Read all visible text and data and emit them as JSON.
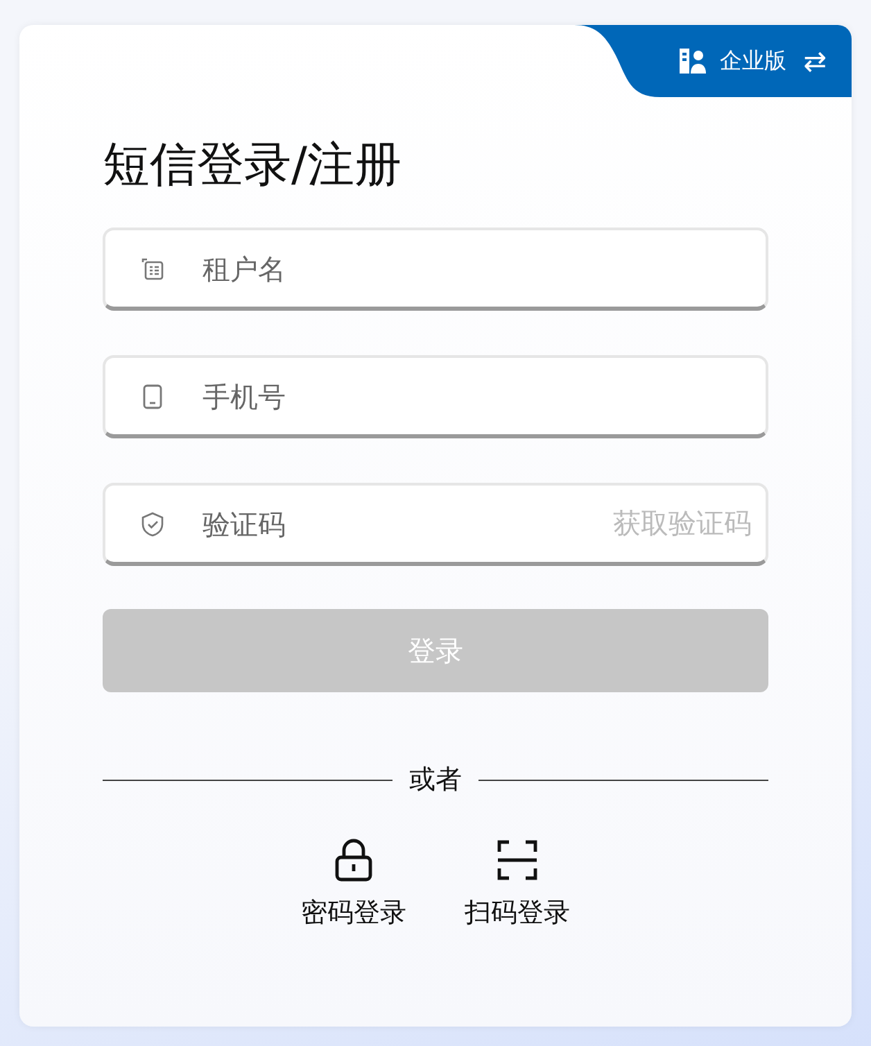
{
  "edition_switch": {
    "label": "企业版",
    "switch_glyph": "⇄"
  },
  "title": "短信登录/注册",
  "fields": [
    {
      "kind": "tenant",
      "placeholder": "租户名"
    },
    {
      "kind": "phone",
      "placeholder": "手机号"
    },
    {
      "kind": "code",
      "placeholder": "验证码",
      "action": "获取验证码",
      "action_disabled": true
    }
  ],
  "submit": {
    "label": "登录",
    "disabled": true
  },
  "divider": "或者",
  "alternatives": [
    {
      "kind": "password",
      "label": "密码登录"
    },
    {
      "kind": "qr",
      "label": "扫码登录"
    }
  ]
}
